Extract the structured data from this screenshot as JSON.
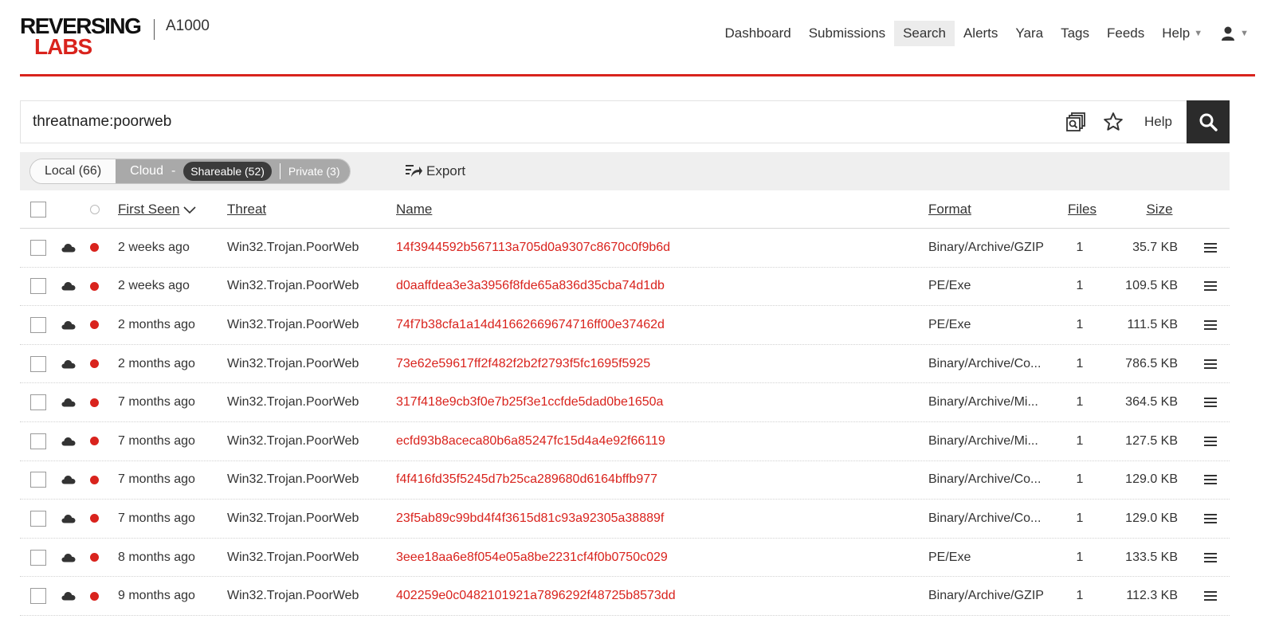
{
  "brand": {
    "logo_line1": "REVERSING",
    "logo_line2": "LABS",
    "product": "A1000",
    "colors": {
      "accent": "#d9231d",
      "dark": "#2b2b2b"
    }
  },
  "nav": {
    "items": [
      "Dashboard",
      "Submissions",
      "Search",
      "Alerts",
      "Yara",
      "Tags",
      "Feeds"
    ],
    "active": "Search",
    "help": "Help",
    "user_icon": "user-icon"
  },
  "search": {
    "query": "threatname:poorweb",
    "help_label": "Help"
  },
  "toolbar": {
    "local": "Local (66)",
    "cloud": "Cloud",
    "cloud_dash": "-",
    "shareable": "Shareable (52)",
    "private": "Private (3)",
    "export": "Export"
  },
  "table": {
    "headers": {
      "first_seen": "First Seen",
      "threat": "Threat",
      "name": "Name",
      "format": "Format",
      "files": "Files",
      "size": "Size"
    },
    "rows": [
      {
        "first_seen": "2 weeks ago",
        "threat": "Win32.Trojan.PoorWeb",
        "name": "14f3944592b567113a705d0a9307c8670c0f9b6d",
        "format": "Binary/Archive/GZIP",
        "files": "1",
        "size": "35.7 KB"
      },
      {
        "first_seen": "2 weeks ago",
        "threat": "Win32.Trojan.PoorWeb",
        "name": "d0aaffdea3e3a3956f8fde65a836d35cba74d1db",
        "format": "PE/Exe",
        "files": "1",
        "size": "109.5 KB"
      },
      {
        "first_seen": "2 months ago",
        "threat": "Win32.Trojan.PoorWeb",
        "name": "74f7b38cfa1a14d41662669674716ff00e37462d",
        "format": "PE/Exe",
        "files": "1",
        "size": "111.5 KB"
      },
      {
        "first_seen": "2 months ago",
        "threat": "Win32.Trojan.PoorWeb",
        "name": "73e62e59617ff2f482f2b2f2793f5fc1695f5925",
        "format": "Binary/Archive/Co...",
        "files": "1",
        "size": "786.5 KB"
      },
      {
        "first_seen": "7 months ago",
        "threat": "Win32.Trojan.PoorWeb",
        "name": "317f418e9cb3f0e7b25f3e1ccfde5dad0be1650a",
        "format": "Binary/Archive/Mi...",
        "files": "1",
        "size": "364.5 KB"
      },
      {
        "first_seen": "7 months ago",
        "threat": "Win32.Trojan.PoorWeb",
        "name": "ecfd93b8aceca80b6a85247fc15d4a4e92f66119",
        "format": "Binary/Archive/Mi...",
        "files": "1",
        "size": "127.5 KB"
      },
      {
        "first_seen": "7 months ago",
        "threat": "Win32.Trojan.PoorWeb",
        "name": "f4f416fd35f5245d7b25ca289680d6164bffb977",
        "format": "Binary/Archive/Co...",
        "files": "1",
        "size": "129.0 KB"
      },
      {
        "first_seen": "7 months ago",
        "threat": "Win32.Trojan.PoorWeb",
        "name": "23f5ab89c99bd4f4f3615d81c93a92305a38889f",
        "format": "Binary/Archive/Co...",
        "files": "1",
        "size": "129.0 KB"
      },
      {
        "first_seen": "8 months ago",
        "threat": "Win32.Trojan.PoorWeb",
        "name": "3eee18aa6e8f054e05a8be2231cf4f0b0750c029",
        "format": "PE/Exe",
        "files": "1",
        "size": "133.5 KB"
      },
      {
        "first_seen": "9 months ago",
        "threat": "Win32.Trojan.PoorWeb",
        "name": "402259e0c0482101921a7896292f48725b8573dd",
        "format": "Binary/Archive/GZIP",
        "files": "1",
        "size": "112.3 KB"
      }
    ]
  }
}
